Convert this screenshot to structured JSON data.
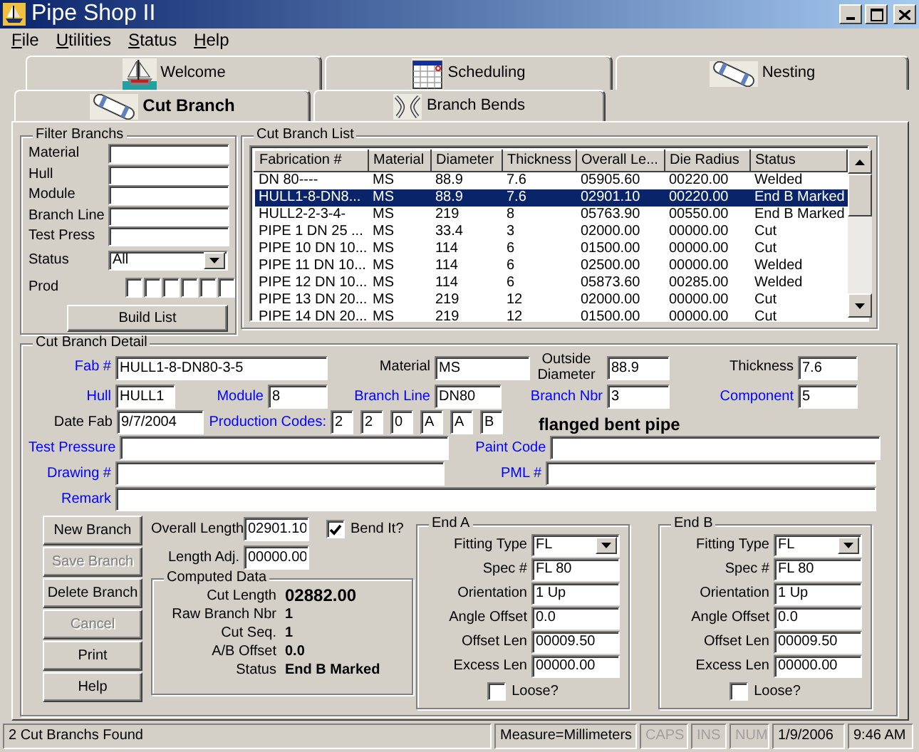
{
  "window": {
    "title": "Pipe Shop II"
  },
  "menu": [
    {
      "label": "File"
    },
    {
      "label": "Utilities"
    },
    {
      "label": "Status"
    },
    {
      "label": "Help"
    }
  ],
  "tabs_back": [
    {
      "label": "Welcome",
      "kind": "ship",
      "selected": false
    },
    {
      "label": "Scheduling",
      "kind": "calendar",
      "selected": false
    },
    {
      "label": "Nesting",
      "kind": "pipe",
      "selected": false
    }
  ],
  "tabs_front": [
    {
      "label": "Cut Branch",
      "kind": "pipe",
      "selected": true
    },
    {
      "label": "Branch Bends",
      "kind": "bend",
      "selected": false
    }
  ],
  "filter": {
    "title": "Filter Branchs",
    "fields": [
      {
        "label": "Material"
      },
      {
        "label": "Hull"
      },
      {
        "label": "Module"
      },
      {
        "label": "Branch Line"
      },
      {
        "label": "Test Press"
      }
    ],
    "status": {
      "label": "Status",
      "value": "All"
    },
    "prod_label": "Prod",
    "button": "Build List"
  },
  "list": {
    "title": "Cut Branch List",
    "columns": [
      "Fabrication #",
      "Material",
      "Diameter",
      "Thickness",
      "Overall Le...",
      "Die Radius",
      "Status"
    ],
    "rows": [
      {
        "cells": [
          "DN 80----",
          "MS",
          "88.9",
          "7.6",
          "05905.60",
          "00220.00",
          "Welded"
        ],
        "selected": false
      },
      {
        "cells": [
          "HULL1-8-DN8...",
          "MS",
          "88.9",
          "7.6",
          "02901.10",
          "00220.00",
          "End B Marked"
        ],
        "selected": true
      },
      {
        "cells": [
          "HULL2-2-3-4-",
          "MS",
          "219",
          "8",
          "05763.90",
          "00550.00",
          "End B Marked"
        ],
        "selected": false
      },
      {
        "cells": [
          "PIPE 1 DN 25 ...",
          "MS",
          "33.4",
          "3",
          "02000.00",
          "00000.00",
          "Cut"
        ],
        "selected": false
      },
      {
        "cells": [
          "PIPE 10 DN 10...",
          "MS",
          "114",
          "6",
          "01500.00",
          "00000.00",
          "Cut"
        ],
        "selected": false
      },
      {
        "cells": [
          "PIPE 11 DN 10...",
          "MS",
          "114",
          "6",
          "02500.00",
          "00000.00",
          "Welded"
        ],
        "selected": false
      },
      {
        "cells": [
          "PIPE 12 DN 10...",
          "MS",
          "114",
          "6",
          "05873.60",
          "00285.00",
          "Welded"
        ],
        "selected": false
      },
      {
        "cells": [
          "PIPE 13 DN 20...",
          "MS",
          "219",
          "12",
          "02000.00",
          "00000.00",
          "Cut"
        ],
        "selected": false
      },
      {
        "cells": [
          "PIPE 14 DN 20...",
          "MS",
          "219",
          "12",
          "01500.00",
          "00000.00",
          "Cut"
        ],
        "selected": false
      }
    ]
  },
  "detail": {
    "title": "Cut Branch Detail",
    "fab": {
      "label": "Fab #",
      "value": "HULL1-8-DN80-3-5",
      "link": true
    },
    "material": {
      "label": "Material",
      "value": "MS",
      "link": false
    },
    "outside_diameter": {
      "label": "Outside Diameter",
      "value": "88.9",
      "link": false
    },
    "thickness": {
      "label": "Thickness",
      "value": "7.6",
      "link": false
    },
    "hull": {
      "label": "Hull",
      "value": "HULL1",
      "link": true
    },
    "module": {
      "label": "Module",
      "value": "8",
      "link": true
    },
    "branch_line": {
      "label": "Branch Line",
      "value": "DN80",
      "link": true
    },
    "branch_nbr": {
      "label": "Branch Nbr",
      "value": "3",
      "link": true
    },
    "component": {
      "label": "Component",
      "value": "5",
      "link": true
    },
    "date_fab": {
      "label": "Date Fab",
      "value": "9/7/2004",
      "link": false
    },
    "production_codes": {
      "label": "Production Codes:",
      "link": true,
      "values": [
        "2",
        "2",
        "0",
        "A",
        "A",
        "B"
      ]
    },
    "description": "flanged bent pipe",
    "test_pressure": {
      "label": "Test Pressure",
      "link": true
    },
    "paint_code": {
      "label": "Paint Code",
      "link": true
    },
    "drawing": {
      "label": "Drawing #",
      "link": true
    },
    "pml": {
      "label": "PML #",
      "link": true
    },
    "remark": {
      "label": "Remark",
      "link": true
    }
  },
  "actions": [
    {
      "label": "New Branch",
      "disabled": false
    },
    {
      "label": "Save Branch",
      "disabled": true
    },
    {
      "label": "Delete Branch",
      "disabled": false
    },
    {
      "label": "Cancel",
      "disabled": true
    },
    {
      "label": "Print",
      "disabled": false
    },
    {
      "label": "Help",
      "disabled": false
    }
  ],
  "overall_length": {
    "label": "Overall Length",
    "value": "02901.10"
  },
  "bend_it": {
    "label": "Bend It?",
    "checked": true
  },
  "length_adj": {
    "label": "Length Adj.",
    "value": "00000.00"
  },
  "computed": {
    "title": "Computed Data",
    "rows": [
      {
        "label": "Cut Length",
        "value": "02882.00"
      },
      {
        "label": "Raw Branch Nbr",
        "value": "1"
      },
      {
        "label": "Cut Seq.",
        "value": "1"
      },
      {
        "label": "A/B Offset",
        "value": "0.0"
      },
      {
        "label": "Status",
        "value": "End B Marked"
      }
    ]
  },
  "ends": [
    {
      "title": "End A",
      "fields": [
        {
          "label": "Fitting Type",
          "value": "FL",
          "kind": "select"
        },
        {
          "label": "Spec #",
          "value": "FL 80",
          "kind": "text"
        },
        {
          "label": "Orientation",
          "value": "1 Up",
          "kind": "text"
        },
        {
          "label": "Angle Offset",
          "value": "0.0",
          "kind": "text"
        },
        {
          "label": "Offset Len",
          "value": "00009.50",
          "kind": "text"
        },
        {
          "label": "Excess Len",
          "value": "00000.00",
          "kind": "text"
        }
      ],
      "loose": {
        "label": "Loose?",
        "checked": false
      }
    },
    {
      "title": "End B",
      "fields": [
        {
          "label": "Fitting Type",
          "value": "FL",
          "kind": "select"
        },
        {
          "label": "Spec #",
          "value": "FL 80",
          "kind": "text"
        },
        {
          "label": "Orientation",
          "value": "1 Up",
          "kind": "text"
        },
        {
          "label": "Angle Offset",
          "value": "0.0",
          "kind": "text"
        },
        {
          "label": "Offset Len",
          "value": "00009.50",
          "kind": "text"
        },
        {
          "label": "Excess Len",
          "value": "00000.00",
          "kind": "text"
        }
      ],
      "loose": {
        "label": "Loose?",
        "checked": false
      }
    }
  ],
  "status_bar": [
    {
      "text": "2 Cut Branchs Found",
      "disabled": false
    },
    {
      "text": "Measure=Millimeters",
      "disabled": false
    },
    {
      "text": "CAPS",
      "disabled": true
    },
    {
      "text": "INS",
      "disabled": true
    },
    {
      "text": "NUM",
      "disabled": true
    },
    {
      "text": "1/9/2006",
      "disabled": false
    },
    {
      "text": "9:46 AM",
      "disabled": false
    }
  ]
}
